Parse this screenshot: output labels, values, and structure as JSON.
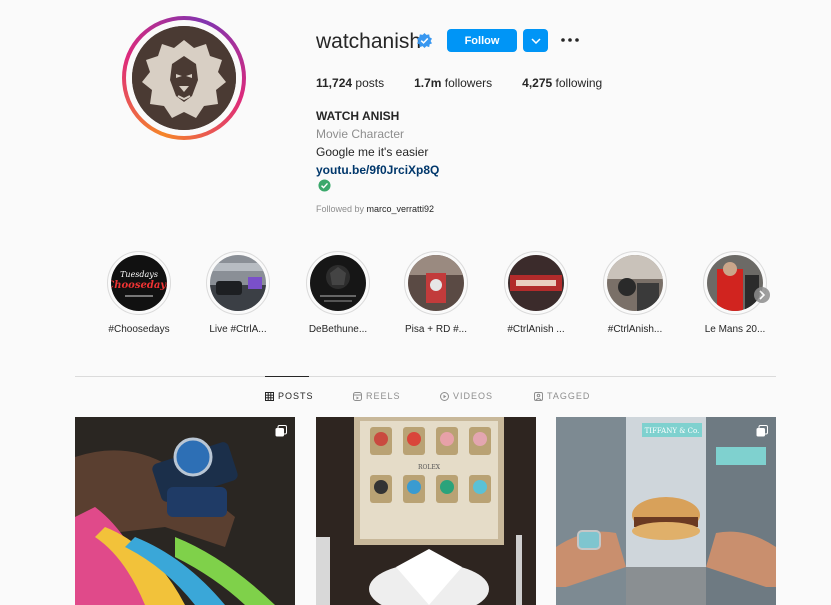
{
  "profile": {
    "username": "watchanish",
    "follow_label": "Follow",
    "more_label": "•••",
    "stats": {
      "posts_value": "11,724",
      "posts_label": "posts",
      "followers_value": "1.7m",
      "followers_label": "followers",
      "following_value": "4,275",
      "following_label": "following"
    },
    "bio": {
      "name": "WATCH ANISH",
      "category": "Movie Character",
      "text": "Google me it's easier",
      "link": "youtu.be/9f0JrciXp8Q"
    },
    "followed_by_prefix": "Followed by ",
    "followed_by_user": "marco_verratti92"
  },
  "highlights": [
    {
      "label": "#Choosedays"
    },
    {
      "label": "Live #CtrlA..."
    },
    {
      "label": "DeBethune..."
    },
    {
      "label": "Pisa + RD #..."
    },
    {
      "label": "#CtrlAnish ..."
    },
    {
      "label": "#CtrlAnish..."
    },
    {
      "label": "Le Mans 20..."
    }
  ],
  "tabs": [
    {
      "label": "POSTS",
      "icon": "grid-icon",
      "active": true
    },
    {
      "label": "REELS",
      "icon": "reels-icon",
      "active": false
    },
    {
      "label": "VIDEOS",
      "icon": "video-icon",
      "active": false
    },
    {
      "label": "TAGGED",
      "icon": "tag-icon",
      "active": false
    }
  ],
  "colors": {
    "accent": "#0095f6",
    "link": "#00376b",
    "avatar_bg": "#4a3a33",
    "muted_text": "#8e8e8e"
  }
}
